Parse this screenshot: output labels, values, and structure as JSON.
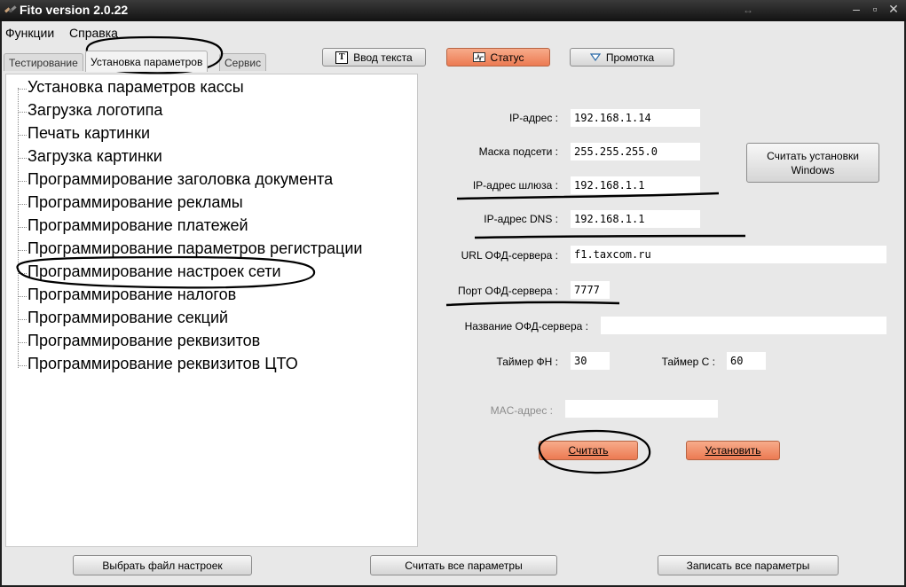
{
  "window": {
    "title": "Fito version 2.0.22"
  },
  "menu": [
    {
      "label": "Функции"
    },
    {
      "label": "Справка"
    }
  ],
  "tabs": [
    {
      "label": "Тестирование"
    },
    {
      "label": "Установка параметров"
    },
    {
      "label": "Сервис"
    }
  ],
  "toolbar": {
    "input_text": "Ввод текста",
    "status": "Статус",
    "feed": "Промотка"
  },
  "tree": [
    {
      "label": "Установка параметров кассы"
    },
    {
      "label": "Загрузка логотипа"
    },
    {
      "label": "Печать картинки"
    },
    {
      "label": "Загрузка картинки"
    },
    {
      "label": "Программирование заголовка документа"
    },
    {
      "label": "Программирование рекламы"
    },
    {
      "label": "Программирование платежей"
    },
    {
      "label": "Программирование параметров регистрации"
    },
    {
      "label": "Программирование настроек сети"
    },
    {
      "label": "Программирование налогов"
    },
    {
      "label": "Программирование секций"
    },
    {
      "label": "Программирование реквизитов"
    },
    {
      "label": "Программирование реквизитов ЦТО"
    }
  ],
  "network": {
    "ip_label": "IP-адрес :",
    "ip": "192.168.1.14",
    "mask_label": "Маска подсети :",
    "mask": "255.255.255.0",
    "gateway_label": "IP-адрес шлюза :",
    "gateway": "192.168.1.1",
    "dns_label": "IP-адрес DNS :",
    "dns": "192.168.1.1",
    "ofd_url_label": "URL ОФД-сервера :",
    "ofd_url": "f1.taxcom.ru",
    "ofd_port_label": "Порт ОФД-сервера :",
    "ofd_port": "7777",
    "ofd_name_label": "Название ОФД-сервера :",
    "ofd_name": "",
    "timer_fn_label": "Таймер ФН :",
    "timer_fn": "30",
    "timer_c_label": "Таймер С :",
    "timer_c": "60",
    "mac_label": "MAC-адрес :",
    "mac": "",
    "read_windows_button": "Считать установки Windows",
    "read_button": "Считать",
    "set_button": "Установить"
  },
  "footer": {
    "choose_file": "Выбрать файл настроек",
    "read_all": "Считать все параметры",
    "write_all": "Записать все параметры"
  },
  "colors": {
    "accent_button": "#f08a62",
    "titlebar": "#1a1a1a",
    "annotation_ink": "#000000"
  },
  "icons": {
    "app": "satellite-icon",
    "input_text": "text-t-icon",
    "status": "monitor-icon",
    "feed": "triangle-down-icon"
  }
}
